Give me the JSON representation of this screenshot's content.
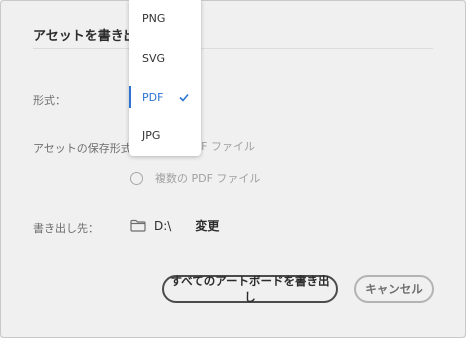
{
  "dialog": {
    "title": "アセットを書き出し",
    "format_label": "形式：",
    "save_format_label": "アセットの保存形式：",
    "save_format_options": [
      {
        "label": "PDF ファイル",
        "selected": false
      },
      {
        "label": "複数の PDF ファイル",
        "selected": false
      }
    ],
    "destination_label": "書き出し先：",
    "destination_path": "D:\\",
    "change_label": "変更",
    "export_button": "すべてのアートボードを書き出し",
    "cancel_button": "キャンセル"
  },
  "dropdown": {
    "items": [
      {
        "label": "PNG"
      },
      {
        "label": "SVG"
      },
      {
        "label": "PDF"
      },
      {
        "label": "JPG"
      }
    ],
    "selected": "PDF"
  },
  "icons": {
    "destination": "folder-icon",
    "selected_marker": "checkmark-icon"
  },
  "colors": {
    "accent": "#2c73d2",
    "dialog_background": "#f0f0f0",
    "text": "#2c2c2c",
    "muted_text": "#6e6e6e",
    "disabled_text": "#a0a0a0"
  }
}
